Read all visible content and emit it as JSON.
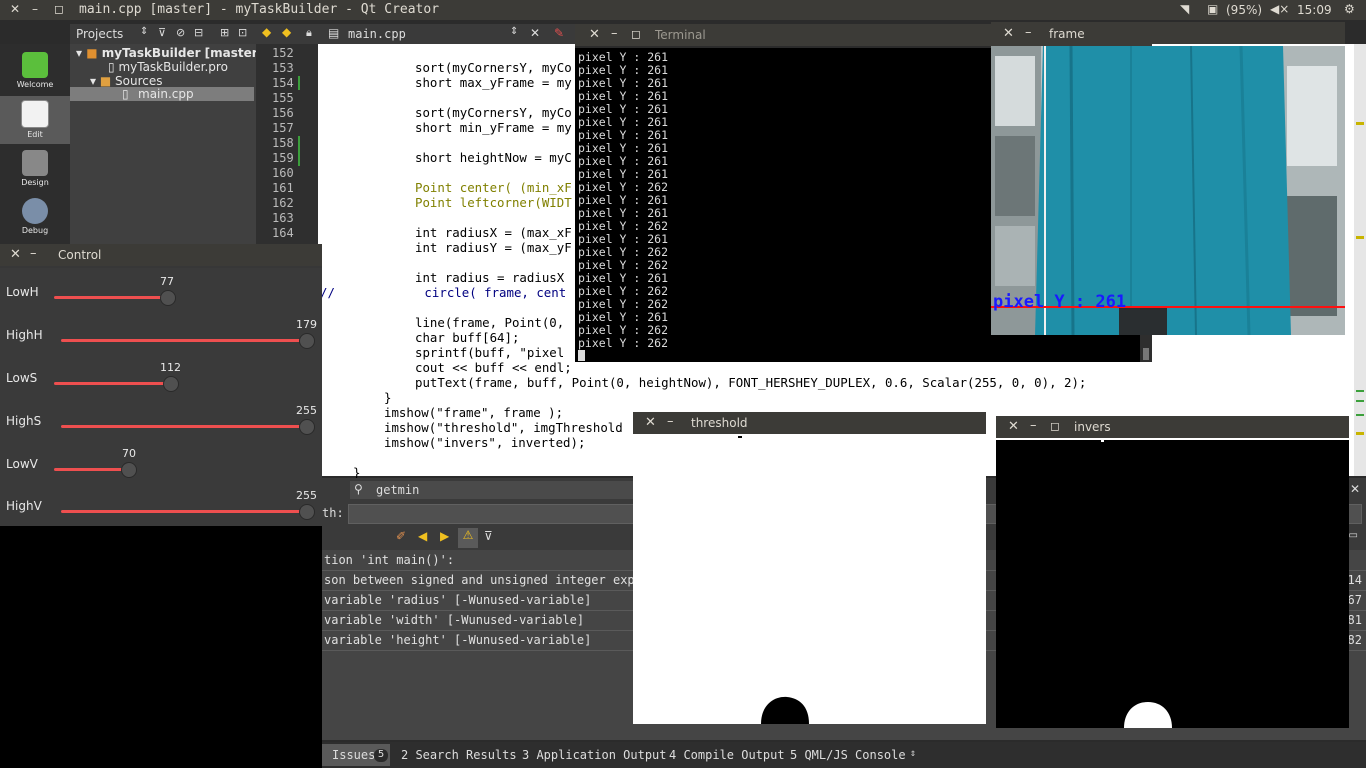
{
  "topbar": {
    "title": "main.cpp [master] - myTaskBuilder - Qt Creator",
    "battery": "(95%)",
    "time": "15:09"
  },
  "modes": [
    {
      "label": "Welcome"
    },
    {
      "label": "Edit"
    },
    {
      "label": "Design"
    },
    {
      "label": "Debug"
    }
  ],
  "navigator": {
    "label": "Projects"
  },
  "editor_tab": {
    "file": "main.cpp"
  },
  "tree": {
    "project": "myTaskBuilder [master]",
    "pro_file": "myTaskBuilder.pro",
    "sources": "Sources",
    "main": "main.cpp"
  },
  "line_numbers": [
    "152",
    "153",
    "154",
    "155",
    "156",
    "157",
    "158",
    "159",
    "160",
    "161",
    "162",
    "163",
    "164"
  ],
  "code": {
    "l152": "sort(myCornersY, myCo",
    "l153": "short max_yFrame = my",
    "l155": "sort(myCornersY, myCo",
    "l156": "short min_yFrame = my",
    "l158": "short heightNow = myC",
    "l160": "Point center( (min_xF",
    "l161": "Point leftcorner(WIDT",
    "l163": "int radiusX = (max_xF",
    "l164": "int radiusY = (max_yF",
    "l166": "int radius = radiusX",
    "l167": "//            circle( frame, cent",
    "l169": "line(frame, Point(0,",
    "l170": "char buff[64];",
    "l171": "sprintf(buff, \"pixel",
    "l172": "cout << buff << endl;",
    "l173": "putText(frame, buff, Point(0, heightNow), FONT_HERSHEY_DUPLEX, 0.6, Scalar(255, 0, 0), 2);",
    "l174": "}",
    "l175": "imshow(\"frame\", frame );",
    "l176": "imshow(\"threshold\", imgThreshold",
    "l177": "imshow(\"invers\", inverted);",
    "l179": "}"
  },
  "terminal": {
    "title": "Terminal",
    "lines": [
      "pixel Y : 261",
      "pixel Y : 261",
      "pixel Y : 261",
      "pixel Y : 261",
      "pixel Y : 261",
      "pixel Y : 261",
      "pixel Y : 261",
      "pixel Y : 261",
      "pixel Y : 261",
      "pixel Y : 261",
      "pixel Y : 262",
      "pixel Y : 261",
      "pixel Y : 261",
      "pixel Y : 262",
      "pixel Y : 261",
      "pixel Y : 262",
      "pixel Y : 262",
      "pixel Y : 261",
      "pixel Y : 262",
      "pixel Y : 262",
      "pixel Y : 261",
      "pixel Y : 262",
      "pixel Y : 262"
    ]
  },
  "frame_window": {
    "title": "frame",
    "overlay_text": "pixel Y : 261"
  },
  "threshold_window": {
    "title": "threshold"
  },
  "invers_window": {
    "title": "invers"
  },
  "control": {
    "title": "Control",
    "sliders": [
      {
        "label": "LowH",
        "value": "77",
        "fraction": 0.43
      },
      {
        "label": "HighH",
        "value": "179",
        "fraction": 1.0
      },
      {
        "label": "LowS",
        "value": "112",
        "fraction": 0.44
      },
      {
        "label": "HighS",
        "value": "255",
        "fraction": 1.0
      },
      {
        "label": "LowV",
        "value": "70",
        "fraction": 0.27
      },
      {
        "label": "HighV",
        "value": "255",
        "fraction": 1.0
      }
    ]
  },
  "output": {
    "search_label": "getmin",
    "path_label": "th:",
    "issues": [
      {
        "text": "tion 'int main()':",
        "line": ""
      },
      {
        "text": "son between signed and unsigned integer expressi",
        "line": "14"
      },
      {
        "text": "variable 'radius' [-Wunused-variable]",
        "line": "67"
      },
      {
        "text": "variable 'width' [-Wunused-variable]",
        "line": "81"
      },
      {
        "text": "variable 'height' [-Wunused-variable]",
        "line": "82"
      }
    ]
  },
  "status_tabs": {
    "issues": "Issues",
    "issues_count": "5",
    "search": "2  Search Results",
    "app_output": "3  Application Output",
    "compile": "4  Compile Output",
    "qml": "5  QML/JS Console"
  },
  "colors": {
    "accent_red": "#ee4f4f",
    "topbar": "#3c3b37",
    "curtain": "#1f8fa8",
    "overlay_blue": "#1a1aff"
  }
}
